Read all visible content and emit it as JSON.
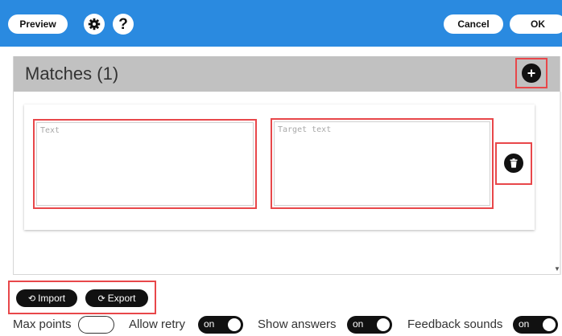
{
  "toolbar": {
    "preview_label": "Preview",
    "settings_icon": "gear-icon",
    "help_label": "?",
    "cancel_label": "Cancel",
    "ok_label": "OK"
  },
  "panel": {
    "title": "Matches (1)",
    "add_icon": "plus-icon"
  },
  "match": {
    "text_value": "",
    "text_placeholder": "Text",
    "target_value": "",
    "target_placeholder": "Target text",
    "delete_icon": "trash-icon"
  },
  "io": {
    "import_label": "Import",
    "export_label": "Export"
  },
  "options": {
    "max_points_label": "Max points",
    "max_points_value": "",
    "allow_retry_label": "Allow retry",
    "allow_retry_state": "on",
    "show_answers_label": "Show answers",
    "show_answers_state": "on",
    "feedback_sounds_label": "Feedback sounds",
    "feedback_sounds_state": "on"
  },
  "colors": {
    "topbar": "#2a8ae0",
    "header": "#c1c1c1",
    "highlight": "#e8474a",
    "toggle_bg": "#111111"
  }
}
